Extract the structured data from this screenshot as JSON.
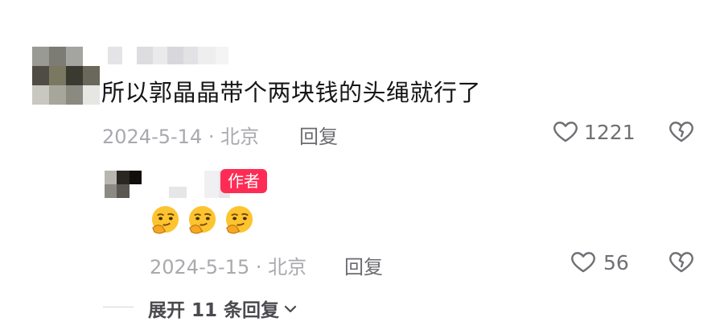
{
  "comment": {
    "text": "所以郭晶晶带个两块钱的头绳就行了",
    "date_location": "2024-5-14 · 北京",
    "reply_label": "回复",
    "like_count": "1221"
  },
  "reply": {
    "author_badge": "作者",
    "emojis": [
      "thinking-emoji",
      "thinking-emoji",
      "thinking-emoji"
    ],
    "date_location": "2024-5-15 · 北京",
    "reply_label": "回复",
    "like_count": "56"
  },
  "expand_replies_label": "展开 11 条回复",
  "colors": {
    "badge": "#fe2c55",
    "meta_text": "#a9a9ae",
    "body_text": "#161616"
  }
}
